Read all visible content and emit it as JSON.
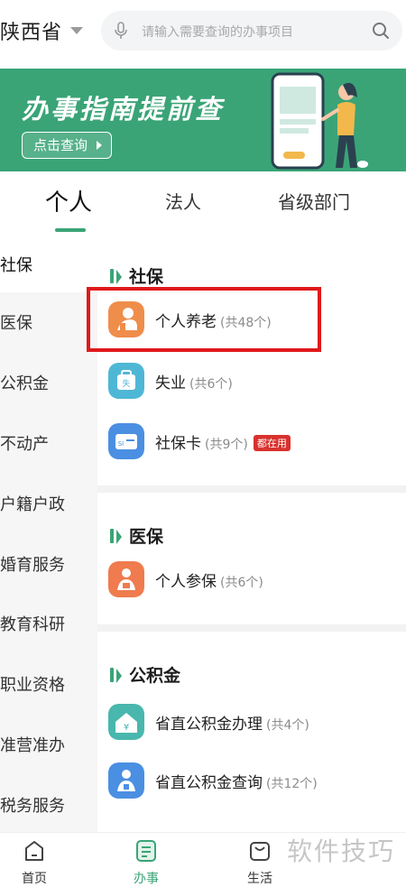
{
  "header": {
    "province": "陕西省",
    "search_placeholder": "请输入需要查询的办事项目"
  },
  "banner": {
    "title": "办事指南提前查",
    "cta": "点击查询"
  },
  "tabs": [
    {
      "label": "个人",
      "active": true
    },
    {
      "label": "法人",
      "active": false
    },
    {
      "label": "省级部门",
      "active": false
    }
  ],
  "sidebar": {
    "items": [
      {
        "label": "社保",
        "active": true
      },
      {
        "label": "医保",
        "active": false
      },
      {
        "label": "公积金",
        "active": false
      },
      {
        "label": "不动产",
        "active": false
      },
      {
        "label": "户籍户政",
        "active": false
      },
      {
        "label": "婚育服务",
        "active": false
      },
      {
        "label": "教育科研",
        "active": false
      },
      {
        "label": "职业资格",
        "active": false
      },
      {
        "label": "准营准办",
        "active": false
      },
      {
        "label": "税务服务",
        "active": false
      }
    ]
  },
  "sections": [
    {
      "title": "社保",
      "items": [
        {
          "label": "个人养老",
          "count": "(共48个)",
          "icon": "person-pension-icon",
          "color": "#ef8d4b"
        },
        {
          "label": "失业",
          "count": "(共6个)",
          "icon": "unemployment-icon",
          "color": "#4fb7d6"
        },
        {
          "label": "社保卡",
          "count": "(共9个)",
          "tag": "都在用",
          "icon": "social-security-card-icon",
          "color": "#4a8fe2"
        }
      ]
    },
    {
      "title": "医保",
      "items": [
        {
          "label": "个人参保",
          "count": "(共6个)",
          "icon": "insurance-icon",
          "color": "#ef7b4e"
        }
      ]
    },
    {
      "title": "公积金",
      "items": [
        {
          "label": "省直公积金办理",
          "count": "(共4个)",
          "icon": "housing-fund-icon",
          "color": "#49b7ad"
        },
        {
          "label": "省直公积金查询",
          "count": "(共12个)",
          "icon": "fund-query-icon",
          "color": "#4a8fe2"
        }
      ]
    }
  ],
  "bottom_nav": [
    {
      "label": "首页",
      "icon": "home-icon"
    },
    {
      "label": "办事",
      "icon": "service-icon",
      "active": true
    },
    {
      "label": "生活",
      "icon": "life-bag-icon"
    }
  ],
  "watermark": "软件技巧",
  "colors": {
    "accent": "#3aa477",
    "highlight_border": "#e0191b",
    "tag_red": "#d8322e"
  }
}
